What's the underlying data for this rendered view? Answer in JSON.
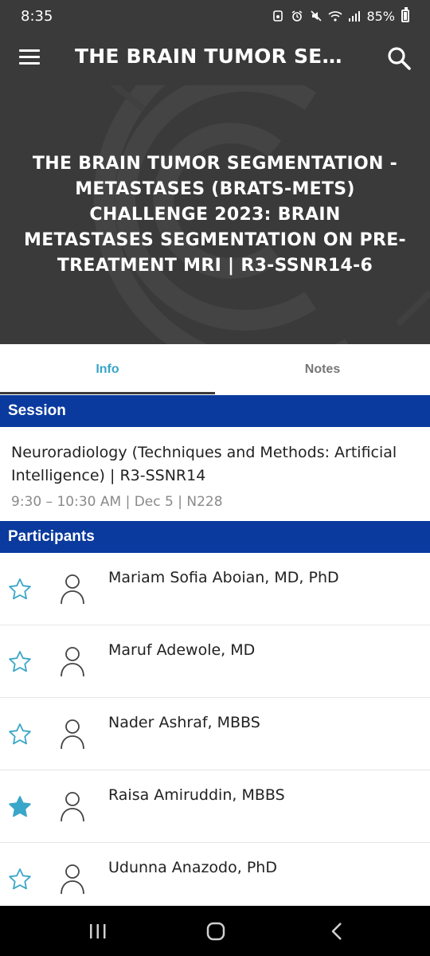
{
  "status_bar": {
    "time": "8:35",
    "battery": "85%",
    "icons": [
      "sim-icon",
      "alarm-icon",
      "mute-icon",
      "wifi-icon",
      "signal-icon",
      "battery-icon"
    ]
  },
  "app_bar": {
    "title": "THE BRAIN TUMOR SEGMENTATION - METASTASES (BRATS-METS) CHALLENGE 2023: BRAIN METASTASES SEGMENTATION ON PRE-TREATMENT MRI | R3-SSNR14-6",
    "menu_icon": "hamburger-menu-icon",
    "search_icon": "search-icon"
  },
  "hero": {
    "title": "THE BRAIN TUMOR SEGMENTATION - METASTASES (BRATS-METS) CHALLENGE 2023: BRAIN METASTASES SEGMENTATION ON PRE-TREATMENT MRI | R3-SSNR14-6"
  },
  "tabs": [
    {
      "label": "Info",
      "active": true
    },
    {
      "label": "Notes",
      "active": false
    }
  ],
  "session": {
    "header": "Session",
    "name": "Neuroradiology (Techniques and Methods: Artificial Intelligence) | R3-SSNR14",
    "meta": "9:30 – 10:30 AM | Dec 5 | N228"
  },
  "participants": {
    "header": "Participants",
    "items": [
      {
        "name": "Mariam Sofia Aboian, MD, PhD",
        "favorited": false
      },
      {
        "name": "Maruf Adewole, MD",
        "favorited": false
      },
      {
        "name": "Nader Ashraf, MBBS",
        "favorited": false
      },
      {
        "name": "Raisa Amiruddin, MBBS",
        "favorited": true
      },
      {
        "name": "Udunna Anazodo, PhD",
        "favorited": false
      }
    ]
  },
  "colors": {
    "app_bar": "#3a3a3a",
    "section_header": "#0a3a9e",
    "accent": "#3aa6c9",
    "star_outline": "#3aa6c9",
    "star_filled": "#3aa6c9"
  },
  "nav_bar": {
    "icons": [
      "recent-apps-icon",
      "home-icon",
      "back-icon"
    ]
  }
}
